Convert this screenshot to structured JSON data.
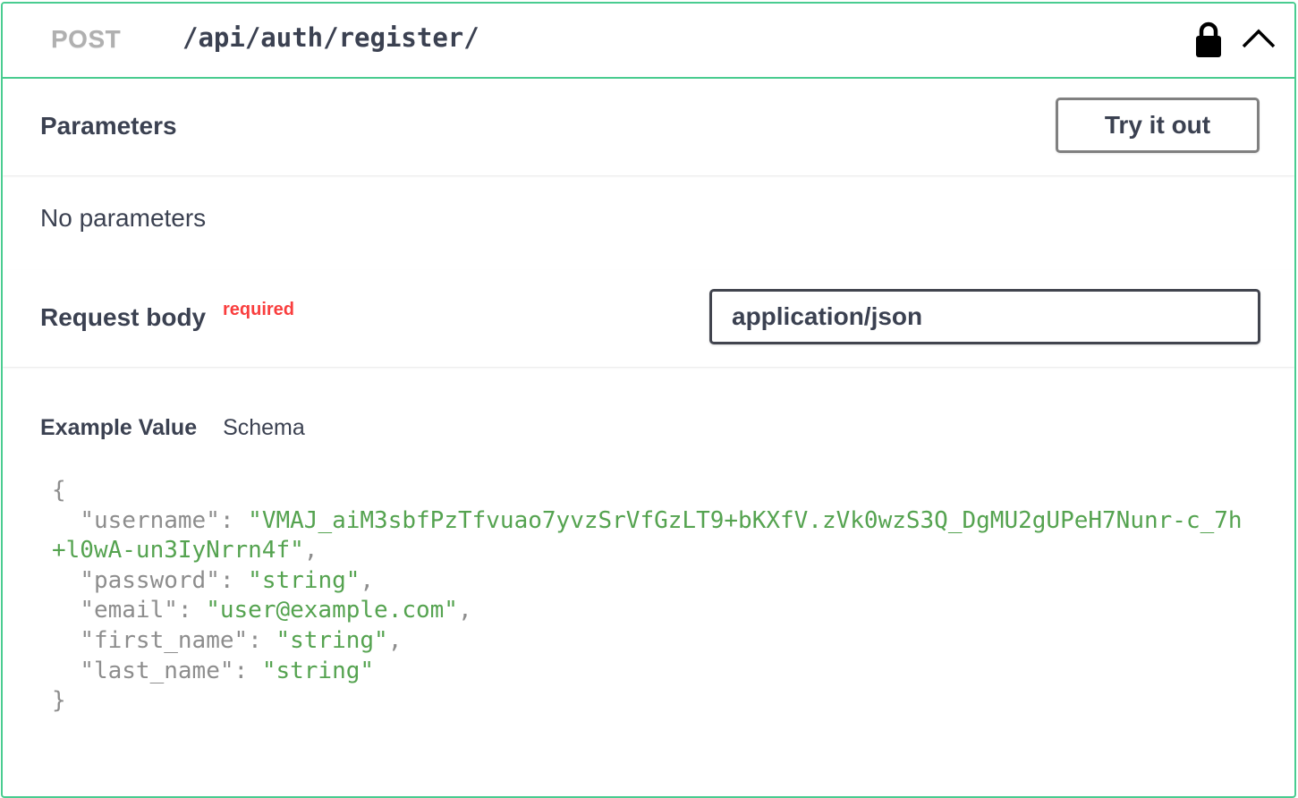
{
  "endpoint": {
    "method": "POST",
    "path": "/api/auth/register/"
  },
  "parameters": {
    "title": "Parameters",
    "try_button_label": "Try it out",
    "empty_text": "No parameters"
  },
  "request_body": {
    "title": "Request body",
    "required_label": "required",
    "content_type": "application/json"
  },
  "example": {
    "tab_example_label": "Example Value",
    "tab_schema_label": "Schema",
    "open_brace": "{",
    "close_brace": "}",
    "fields": [
      {
        "key": "\"username\"",
        "value": "\"VMAJ_aiM3sbfPzTfvuao7yvzSrVfGzLT9+bKXfV.zVk0wzS3Q_DgMU2gUPeH7Nunr-c_7h+l0wA-un3IyNrrn4f\""
      },
      {
        "key": "\"password\"",
        "value": "\"string\""
      },
      {
        "key": "\"email\"",
        "value": "\"user@example.com\""
      },
      {
        "key": "\"first_name\"",
        "value": "\"string\""
      },
      {
        "key": "\"last_name\"",
        "value": "\"string\""
      }
    ]
  },
  "colors": {
    "post_border": "#49cc90",
    "required": "#f93e3e",
    "string_value": "#55a350",
    "key": "#8d8d8d",
    "text": "#3b4151"
  },
  "icons": {
    "lock": "lock-icon",
    "collapse": "chevron-up-icon"
  }
}
